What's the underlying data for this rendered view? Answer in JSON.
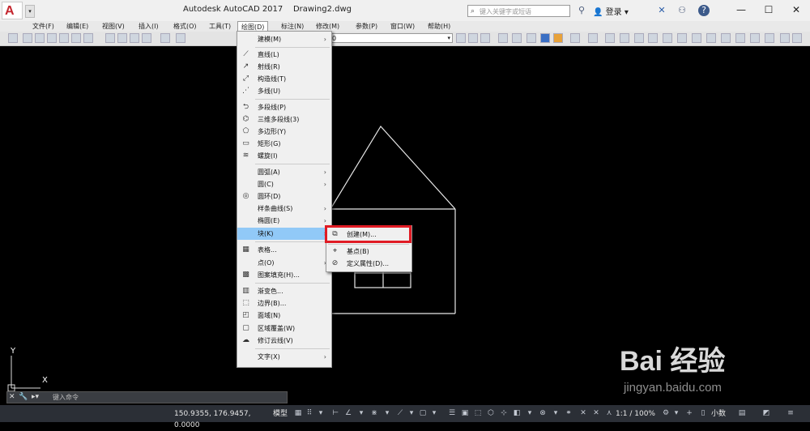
{
  "titlebar": {
    "title": "Autodesk AutoCAD 2017    Drawing2.dwg",
    "search_placeholder": "键入关键字或短语",
    "login_label": "登录",
    "minimize": "—",
    "maximize": "☐",
    "close": "✕"
  },
  "menubar": {
    "items": [
      "文件(F)",
      "编辑(E)",
      "视图(V)",
      "插入(I)",
      "格式(O)",
      "工具(T)",
      "绘图(D)",
      "标注(N)",
      "修改(M)",
      "参数(P)",
      "窗口(W)",
      "帮助(H)"
    ]
  },
  "toolbar": {
    "layer_value": "0"
  },
  "draw_menu": {
    "items": [
      {
        "label": "建模(M)",
        "has_sub": true
      },
      {
        "label": "直线(L)"
      },
      {
        "label": "射线(R)"
      },
      {
        "label": "构造线(T)"
      },
      {
        "label": "多线(U)"
      },
      {
        "label": "多段线(P)"
      },
      {
        "label": "三维多段线(3)"
      },
      {
        "label": "多边形(Y)"
      },
      {
        "label": "矩形(G)"
      },
      {
        "label": "螺旋(I)"
      },
      {
        "label": "圆弧(A)",
        "has_sub": true
      },
      {
        "label": "圆(C)",
        "has_sub": true
      },
      {
        "label": "圆环(D)"
      },
      {
        "label": "样条曲线(S)",
        "has_sub": true
      },
      {
        "label": "椭圆(E)",
        "has_sub": true
      },
      {
        "label": "块(K)",
        "has_sub": true
      },
      {
        "label": "表格..."
      },
      {
        "label": "点(O)",
        "has_sub": true
      },
      {
        "label": "图案填充(H)..."
      },
      {
        "label": "渐变色..."
      },
      {
        "label": "边界(B)..."
      },
      {
        "label": "面域(N)"
      },
      {
        "label": "区域覆盖(W)"
      },
      {
        "label": "修订云线(V)"
      },
      {
        "label": "文字(X)",
        "has_sub": true
      }
    ],
    "sub_arrow": "›"
  },
  "block_submenu": {
    "items": [
      "创建(M)...",
      "基点(B)",
      "定义属性(D)..."
    ]
  },
  "ucs": {
    "x": "X",
    "y": "Y"
  },
  "command_line": {
    "placeholder": "键入命令",
    "close": "✕"
  },
  "statusbar": {
    "coords": "150.9355, 176.9457, 0.0000",
    "model": "模型",
    "scale": "1:1 / 100%",
    "units": "小数"
  },
  "watermark": {
    "brand": "Bai 经验",
    "url": "jingyan.baidu.com"
  }
}
